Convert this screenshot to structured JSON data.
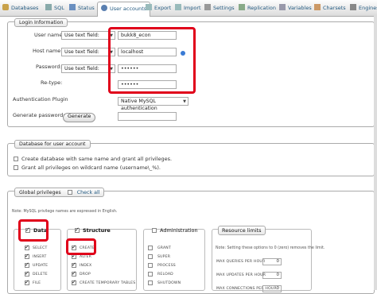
{
  "tabs": [
    {
      "label": "Databases",
      "icon": "database-icon"
    },
    {
      "label": "SQL",
      "icon": "sql-icon"
    },
    {
      "label": "Status",
      "icon": "status-icon"
    },
    {
      "label": "User accounts",
      "icon": "users-icon"
    },
    {
      "label": "Export",
      "icon": "export-icon"
    },
    {
      "label": "Import",
      "icon": "import-icon"
    },
    {
      "label": "Settings",
      "icon": "wrench-icon"
    },
    {
      "label": "Replication",
      "icon": "replication-icon"
    },
    {
      "label": "Variables",
      "icon": "variables-icon"
    },
    {
      "label": "Charsets",
      "icon": "charsets-icon"
    },
    {
      "label": "Engines",
      "icon": "engines-icon"
    }
  ],
  "login": {
    "legend": "Login Information",
    "user_name_label": "User name:",
    "user_name_mode": "Use text field:",
    "user_name_value": "bukk8_econ",
    "host_label": "Host name:",
    "host_mode": "Use text field:",
    "host_value": "localhost",
    "password_label": "Password:",
    "password_mode": "Use text field:",
    "password_value": "••••••",
    "retype_label": "Re-type:",
    "retype_value": "••••••",
    "auth_label": "Authentication Plugin",
    "auth_value": "Native MySQL authentication",
    "generate_label": "Generate password:",
    "generate_button": "Generate"
  },
  "database": {
    "legend": "Database for user account",
    "opt1": "Create database with same name and grant all privileges.",
    "opt2": "Grant all privileges on wildcard name (username\\_%)."
  },
  "global": {
    "legend": "Global privileges",
    "check_all": "Check all",
    "note": "Note: MySQL privilege names are expressed in English.",
    "data": {
      "title": "Data",
      "items": [
        "SELECT",
        "INSERT",
        "UPDATE",
        "DELETE",
        "FILE"
      ]
    },
    "structure": {
      "title": "Structure",
      "items": [
        "CREATE",
        "ALTER",
        "INDEX",
        "DROP",
        "CREATE TEMPORARY TABLES"
      ]
    },
    "administration": {
      "title": "Administration",
      "items": [
        "GRANT",
        "SUPER",
        "PROCESS",
        "RELOAD",
        "SHUTDOWN"
      ]
    },
    "limits": {
      "title": "Resource limits",
      "note": "Note: Setting these options to 0 (zero) removes the limit.",
      "rows": [
        {
          "label": "MAX QUERIES PER HOUR",
          "value": "0"
        },
        {
          "label": "MAX UPDATES PER HOUR",
          "value": "0"
        },
        {
          "label": "MAX CONNECTIONS PER HOUR",
          "value": "0"
        }
      ]
    }
  },
  "colors": {
    "annotation": "#e0001a",
    "link": "#235a81"
  }
}
